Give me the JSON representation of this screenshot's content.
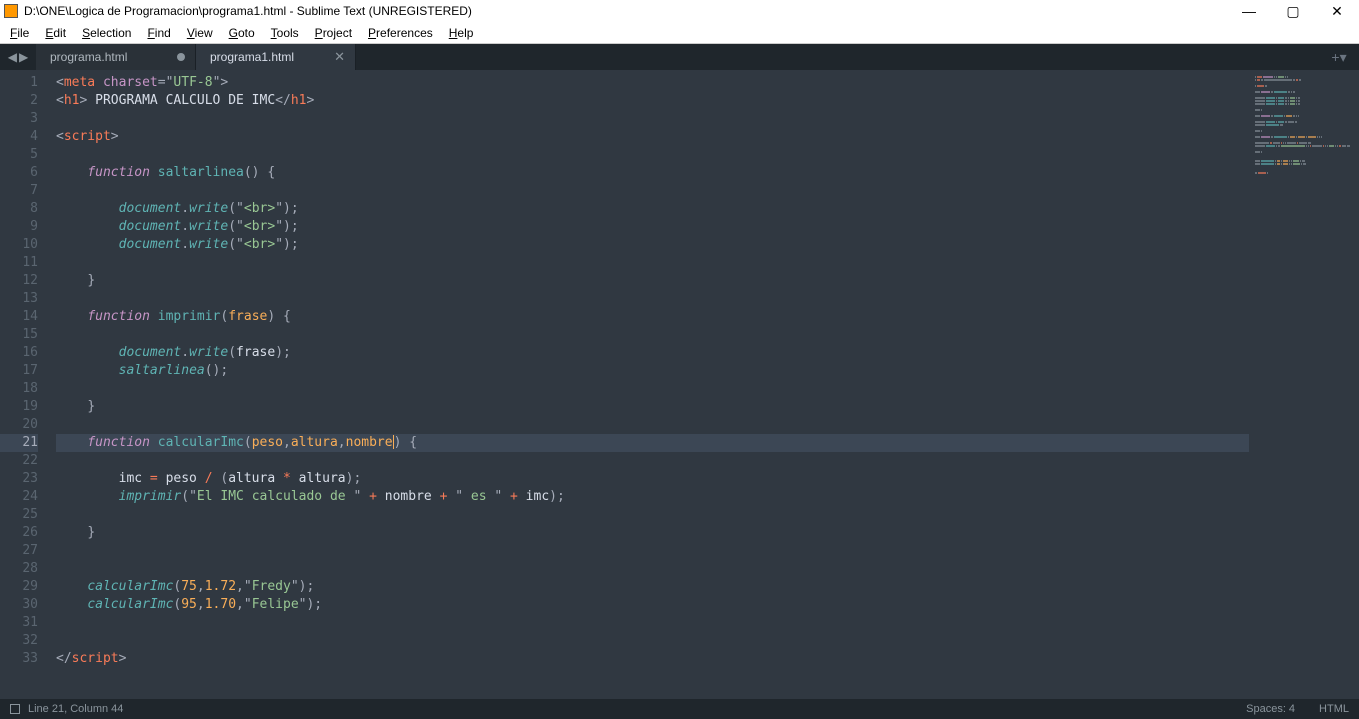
{
  "window": {
    "title": "D:\\ONE\\Logica de Programacion\\programa1.html - Sublime Text (UNREGISTERED)"
  },
  "menus": [
    "File",
    "Edit",
    "Selection",
    "Find",
    "View",
    "Goto",
    "Tools",
    "Project",
    "Preferences",
    "Help"
  ],
  "tabs": [
    {
      "label": "programa.html",
      "dirty": true,
      "active": false
    },
    {
      "label": "programa1.html",
      "dirty": false,
      "active": true
    }
  ],
  "status": {
    "pos": "Line 21, Column 44",
    "spaces": "Spaces: 4",
    "syntax": "HTML"
  },
  "code": {
    "current_line": 21,
    "lines": [
      {
        "n": 1,
        "tokens": [
          [
            "c-punc",
            "<"
          ],
          [
            "c-tag",
            "meta"
          ],
          [
            "",
            ""
          ],
          [
            "",
            ""
          ],
          [
            "c-attr",
            " charset"
          ],
          [
            "c-punc",
            "="
          ],
          [
            "c-punc",
            "\""
          ],
          [
            "c-str",
            "UTF-8"
          ],
          [
            "c-punc",
            "\""
          ],
          [
            "c-punc",
            ">"
          ]
        ]
      },
      {
        "n": 2,
        "tokens": [
          [
            "c-punc",
            "<"
          ],
          [
            "c-tag",
            "h1"
          ],
          [
            "c-punc",
            "> "
          ],
          [
            "",
            "PROGRAMA CALCULO DE IMC"
          ],
          [
            "c-punc",
            "</"
          ],
          [
            "c-tag",
            "h1"
          ],
          [
            "c-punc",
            ">"
          ]
        ]
      },
      {
        "n": 3,
        "tokens": []
      },
      {
        "n": 4,
        "tokens": [
          [
            "c-punc",
            "<"
          ],
          [
            "c-tag",
            "script"
          ],
          [
            "c-punc",
            ">"
          ]
        ]
      },
      {
        "n": 5,
        "tokens": []
      },
      {
        "n": 6,
        "tokens": [
          [
            "",
            "    "
          ],
          [
            "c-storage",
            "function"
          ],
          [
            "",
            " "
          ],
          [
            "c-fn",
            "saltarlinea"
          ],
          [
            "c-punc",
            "()"
          ],
          [
            "",
            " "
          ],
          [
            "c-punc",
            "{"
          ]
        ]
      },
      {
        "n": 7,
        "tokens": []
      },
      {
        "n": 8,
        "tokens": [
          [
            "",
            "        "
          ],
          [
            "c-obj",
            "document"
          ],
          [
            "c-punc",
            "."
          ],
          [
            "c-fnit",
            "write"
          ],
          [
            "c-punc",
            "("
          ],
          [
            "c-punc",
            "\""
          ],
          [
            "c-str",
            "<br>"
          ],
          [
            "c-punc",
            "\""
          ],
          [
            "c-punc",
            ");"
          ]
        ]
      },
      {
        "n": 9,
        "tokens": [
          [
            "",
            "        "
          ],
          [
            "c-obj",
            "document"
          ],
          [
            "c-punc",
            "."
          ],
          [
            "c-fnit",
            "write"
          ],
          [
            "c-punc",
            "("
          ],
          [
            "c-punc",
            "\""
          ],
          [
            "c-str",
            "<br>"
          ],
          [
            "c-punc",
            "\""
          ],
          [
            "c-punc",
            ");"
          ]
        ]
      },
      {
        "n": 10,
        "tokens": [
          [
            "",
            "        "
          ],
          [
            "c-obj",
            "document"
          ],
          [
            "c-punc",
            "."
          ],
          [
            "c-fnit",
            "write"
          ],
          [
            "c-punc",
            "("
          ],
          [
            "c-punc",
            "\""
          ],
          [
            "c-str",
            "<br>"
          ],
          [
            "c-punc",
            "\""
          ],
          [
            "c-punc",
            ");"
          ]
        ]
      },
      {
        "n": 11,
        "tokens": []
      },
      {
        "n": 12,
        "tokens": [
          [
            "",
            "    "
          ],
          [
            "c-punc",
            "}"
          ]
        ]
      },
      {
        "n": 13,
        "tokens": []
      },
      {
        "n": 14,
        "tokens": [
          [
            "",
            "    "
          ],
          [
            "c-storage",
            "function"
          ],
          [
            "",
            " "
          ],
          [
            "c-fn",
            "imprimir"
          ],
          [
            "c-punc",
            "("
          ],
          [
            "c-param",
            "frase"
          ],
          [
            "c-punc",
            ")"
          ],
          [
            "",
            " "
          ],
          [
            "c-punc",
            "{"
          ]
        ]
      },
      {
        "n": 15,
        "tokens": []
      },
      {
        "n": 16,
        "tokens": [
          [
            "",
            "        "
          ],
          [
            "c-obj",
            "document"
          ],
          [
            "c-punc",
            "."
          ],
          [
            "c-fnit",
            "write"
          ],
          [
            "c-punc",
            "("
          ],
          [
            "",
            "frase"
          ],
          [
            "c-punc",
            ");"
          ]
        ]
      },
      {
        "n": 17,
        "tokens": [
          [
            "",
            "        "
          ],
          [
            "c-fnit",
            "saltarlinea"
          ],
          [
            "c-punc",
            "();"
          ]
        ]
      },
      {
        "n": 18,
        "tokens": []
      },
      {
        "n": 19,
        "tokens": [
          [
            "",
            "    "
          ],
          [
            "c-punc",
            "}"
          ]
        ]
      },
      {
        "n": 20,
        "tokens": []
      },
      {
        "n": 21,
        "tokens": [
          [
            "",
            "    "
          ],
          [
            "c-storage",
            "function"
          ],
          [
            "",
            " "
          ],
          [
            "c-fn",
            "calcularImc"
          ],
          [
            "c-punc",
            "("
          ],
          [
            "c-param",
            "peso"
          ],
          [
            "c-punc",
            ","
          ],
          [
            "c-param",
            "altura"
          ],
          [
            "c-punc",
            ","
          ],
          [
            "c-param",
            "nombre"
          ],
          [
            "CURSOR",
            ""
          ],
          [
            "c-punc",
            ")"
          ],
          [
            "",
            " "
          ],
          [
            "c-punc",
            "{"
          ]
        ]
      },
      {
        "n": 22,
        "tokens": []
      },
      {
        "n": 23,
        "tokens": [
          [
            "",
            "        imc "
          ],
          [
            "c-op",
            "="
          ],
          [
            "",
            " peso "
          ],
          [
            "c-op",
            "/"
          ],
          [
            "",
            " "
          ],
          [
            "c-punc",
            "("
          ],
          [
            "",
            "altura "
          ],
          [
            "c-op",
            "*"
          ],
          [
            "",
            " altura"
          ],
          [
            "c-punc",
            ");"
          ]
        ]
      },
      {
        "n": 24,
        "tokens": [
          [
            "",
            "        "
          ],
          [
            "c-fnit",
            "imprimir"
          ],
          [
            "c-punc",
            "("
          ],
          [
            "c-punc",
            "\""
          ],
          [
            "c-str",
            "El IMC calculado de "
          ],
          [
            "c-punc",
            "\""
          ],
          [
            "",
            " "
          ],
          [
            "c-op",
            "+"
          ],
          [
            "",
            " nombre "
          ],
          [
            "c-op",
            "+"
          ],
          [
            "",
            " "
          ],
          [
            "c-punc",
            "\""
          ],
          [
            "c-str",
            " es "
          ],
          [
            "c-punc",
            "\""
          ],
          [
            "",
            " "
          ],
          [
            "c-op",
            "+"
          ],
          [
            "",
            " imc"
          ],
          [
            "c-punc",
            ");"
          ]
        ]
      },
      {
        "n": 25,
        "tokens": []
      },
      {
        "n": 26,
        "tokens": [
          [
            "",
            "    "
          ],
          [
            "c-punc",
            "}"
          ]
        ]
      },
      {
        "n": 27,
        "tokens": []
      },
      {
        "n": 28,
        "tokens": []
      },
      {
        "n": 29,
        "tokens": [
          [
            "",
            "    "
          ],
          [
            "c-fnit",
            "calcularImc"
          ],
          [
            "c-punc",
            "("
          ],
          [
            "c-num",
            "75"
          ],
          [
            "c-punc",
            ","
          ],
          [
            "c-num",
            "1.72"
          ],
          [
            "c-punc",
            ","
          ],
          [
            "c-punc",
            "\""
          ],
          [
            "c-str",
            "Fredy"
          ],
          [
            "c-punc",
            "\""
          ],
          [
            "c-punc",
            ");"
          ]
        ]
      },
      {
        "n": 30,
        "tokens": [
          [
            "",
            "    "
          ],
          [
            "c-fnit",
            "calcularImc"
          ],
          [
            "c-punc",
            "("
          ],
          [
            "c-num",
            "95"
          ],
          [
            "c-punc",
            ","
          ],
          [
            "c-num",
            "1.70"
          ],
          [
            "c-punc",
            ","
          ],
          [
            "c-punc",
            "\""
          ],
          [
            "c-str",
            "Felipe"
          ],
          [
            "c-punc",
            "\""
          ],
          [
            "c-punc",
            ");"
          ]
        ]
      },
      {
        "n": 31,
        "tokens": []
      },
      {
        "n": 32,
        "tokens": []
      },
      {
        "n": 33,
        "tokens": [
          [
            "c-punc",
            "</"
          ],
          [
            "c-tag",
            "script"
          ],
          [
            "c-punc",
            ">"
          ]
        ]
      }
    ]
  },
  "icons": {
    "min": "—",
    "max": "▢",
    "close": "✕",
    "left": "◀",
    "right": "▶",
    "plus": "+",
    "down": "▾"
  }
}
